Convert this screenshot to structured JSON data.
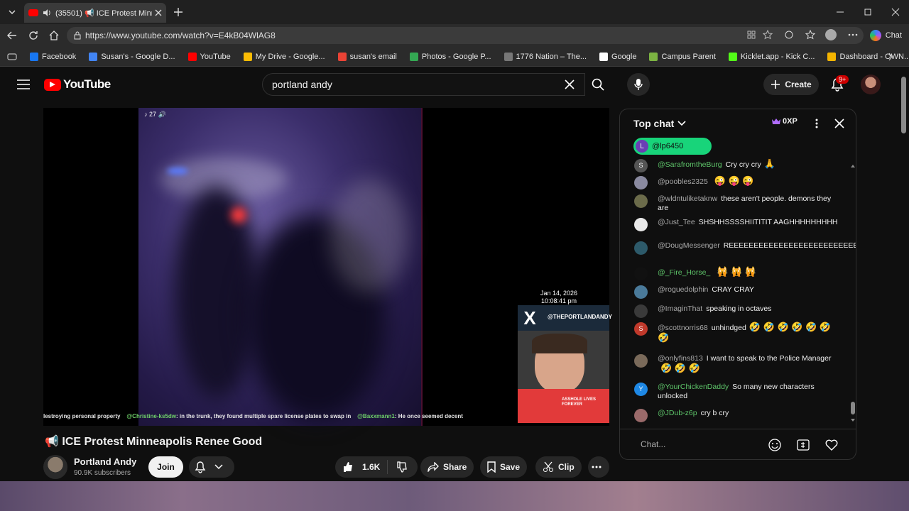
{
  "browser": {
    "tab": {
      "badge_count": "(35501)",
      "title": "(35501) 📢 ICE Protest Minne..."
    },
    "url": "https://www.youtube.com/watch?v=E4kB04WlAG8",
    "chat_label": "Chat",
    "bookmarks": [
      {
        "label": "Facebook",
        "color": "#1877f2"
      },
      {
        "label": "Susan's - Google D...",
        "color": "#4285f4"
      },
      {
        "label": "YouTube",
        "color": "#ff0000"
      },
      {
        "label": "My Drive - Google...",
        "color": "#fbbc04"
      },
      {
        "label": "susan's email",
        "color": "#ea4335"
      },
      {
        "label": "Photos - Google P...",
        "color": "#34a853"
      },
      {
        "label": "1776 Nation – The...",
        "color": "#777777"
      },
      {
        "label": "Google",
        "color": "#ffffff"
      },
      {
        "label": "Campus Parent",
        "color": "#7cb342"
      },
      {
        "label": "Kicklet.app - Kick C...",
        "color": "#53fc18"
      },
      {
        "label": "Dashboard - OWN...",
        "color": "#f4b400"
      }
    ]
  },
  "youtube": {
    "logo": "YouTube",
    "search_query": "portland andy",
    "create_label": "Create",
    "notif_badge": "9+"
  },
  "player": {
    "tiktok_tag": "27",
    "ticker": [
      {
        "user": "",
        "text": "lestroying personal property"
      },
      {
        "user": "@Christine-ks5dw",
        "text": ": in the trunk, they found multiple spare license plates to swap in"
      },
      {
        "user": "@Baxxmann1",
        "text": ": He once seemed decent"
      }
    ],
    "timestamp_date": "Jan 14, 2026",
    "timestamp_time": "10:08:41 pm",
    "x_handle": "@THEPORTLANDANDY",
    "webcam_shirt_text": "ASSHOLE LIVES FOREVER"
  },
  "video": {
    "title": "📢 ICE Protest Minneapolis Renee Good",
    "channel_name": "Portland Andy",
    "subscribers": "90.9K subscribers",
    "join_label": "Join",
    "like_count": "1.6K",
    "share_label": "Share",
    "save_label": "Save",
    "clip_label": "Clip"
  },
  "chat": {
    "title": "Top chat",
    "xp": "0XP",
    "pinned_initial": "L",
    "pinned_user": "@lp6450",
    "input_placeholder": "Chat...",
    "messages": [
      {
        "initial": "S",
        "avatar_color": "#555555",
        "author": "@SarafromtheBurg",
        "green": true,
        "text": "Cry cry cry",
        "emoji": "🙏"
      },
      {
        "initial": "",
        "avatar_color": "#8a8aa0",
        "author": "@poobles2325",
        "green": false,
        "text": "",
        "emoji": "😜 😜 😜"
      },
      {
        "initial": "",
        "avatar_color": "#6b6b4a",
        "author": "@wldntuliketaknw",
        "green": false,
        "text": "these aren't people. demons they are",
        "emoji": ""
      },
      {
        "initial": "",
        "avatar_color": "#e8e8e8",
        "author": "@Just_Tee",
        "green": false,
        "text": "SHSHHSSSSHIITITIT AAGHHHHHHHHH",
        "emoji": ""
      },
      {
        "initial": "",
        "avatar_color": "#2d5a6a",
        "author": "@DougMessenger",
        "green": false,
        "text": "REEEEEEEEEEEEEEEEEEEEEEEEEEE",
        "emoji": ""
      },
      {
        "initial": "",
        "avatar_color": "#111111",
        "author": "@_Fire_Horse_",
        "green": true,
        "text": "",
        "emoji": "🙀 🙀 🙀"
      },
      {
        "initial": "",
        "avatar_color": "#4a7a9a",
        "author": "@roguedolphin",
        "green": false,
        "text": "CRAY CRAY",
        "emoji": ""
      },
      {
        "initial": "",
        "avatar_color": "#3a3a3a",
        "author": "@ImaginThat",
        "green": false,
        "text": "speaking in octaves",
        "emoji": ""
      },
      {
        "initial": "S",
        "avatar_color": "#c0392b",
        "author": "@scottnorris68",
        "green": false,
        "text": "unhindged",
        "emoji": "🤣 🤣 🤣 🤣 🤣 🤣 🤣"
      },
      {
        "initial": "",
        "avatar_color": "#7a6a5a",
        "author": "@onlyfins813",
        "green": false,
        "text": "I want to speak to the Police Manager",
        "emoji": "🤣 🤣 🤣"
      },
      {
        "initial": "Y",
        "avatar_color": "#1e88e5",
        "author": "@YourChickenDaddy",
        "green": true,
        "text": "So many new characters unlocked",
        "emoji": ""
      },
      {
        "initial": "",
        "avatar_color": "#9a6a6a",
        "author": "@JDub-z6p",
        "green": true,
        "text": "cry b cry",
        "emoji": ""
      }
    ]
  }
}
